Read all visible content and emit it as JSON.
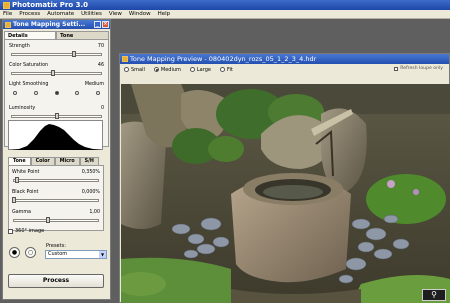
{
  "app": {
    "title": "Photomatix Pro 3.0"
  },
  "menu": [
    "File",
    "Process",
    "Automate",
    "Utilities",
    "View",
    "Window",
    "Help"
  ],
  "tone_panel": {
    "title": "Tone Mapping Setti...",
    "tabs": [
      "Details Enhancer",
      "Tone Compressor"
    ],
    "controls": [
      {
        "label": "Strength",
        "value": "70",
        "fraction": 0.7
      },
      {
        "label": "Color Saturation",
        "value": "46",
        "fraction": 0.46
      },
      {
        "label": "Light Smoothing",
        "value": "Medium",
        "fraction": 0.5
      },
      {
        "label": "Luminosity",
        "value": "0",
        "fraction": 0.5
      }
    ],
    "smoothing_dots": 5,
    "smoothing_selected": 2,
    "sub_tabs": [
      "Tone",
      "Color",
      "Micro",
      "S/H"
    ],
    "tone_controls": [
      {
        "label": "White Point",
        "value": "0,350%",
        "fraction": 0.04
      },
      {
        "label": "Black Point",
        "value": "0,000%",
        "fraction": 0.0
      },
      {
        "label": "Gamma",
        "value": "1,00",
        "fraction": 0.4
      }
    ],
    "image360_label": "360° image",
    "presets_label": "Presets:",
    "presets_value": "Custom",
    "process_label": "Process"
  },
  "preview": {
    "title": "Tone Mapping Preview - 080402dyn_rozs_05_1_2_3_4.hdr",
    "size_options": [
      "Small",
      "Medium",
      "Large",
      "Fit"
    ],
    "selected_size": "Medium",
    "refresh_label": "Refresh loupe only"
  },
  "colors": {
    "titlebar": "#2350b0",
    "panel_bg": "#ece9d8",
    "workspace": "#5f5f5f"
  }
}
